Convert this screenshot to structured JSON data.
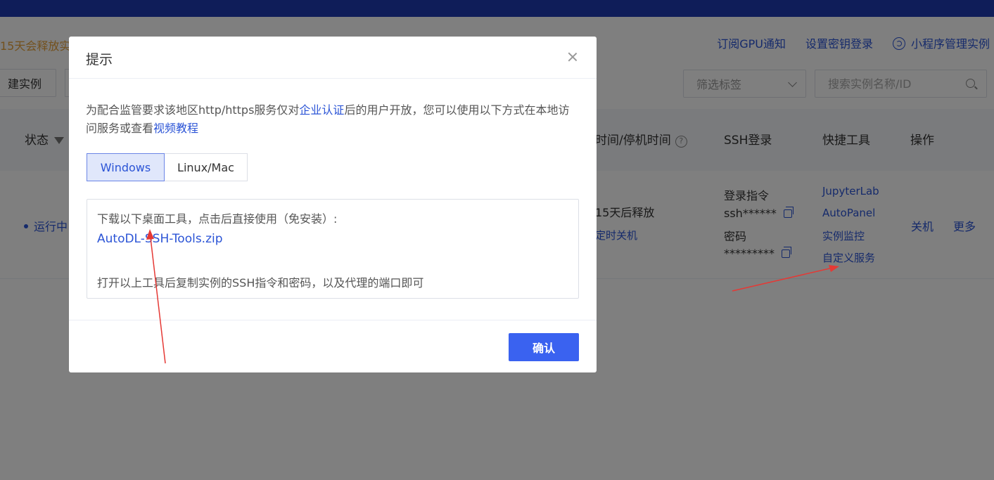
{
  "notice": "15天会释放实",
  "top_links": {
    "subscribe": "订阅GPU通知",
    "key_login": "设置密钥登录",
    "mini_program": "小程序管理实例"
  },
  "toolbar": {
    "create_label": "建实例",
    "filter_placeholder": "筛选标签",
    "search_placeholder": "搜索实例名称/ID"
  },
  "table": {
    "headers": {
      "status": "状态",
      "time": "时间/停机时间",
      "ssh": "SSH登录",
      "tools": "快捷工具",
      "ops": "操作"
    },
    "row": {
      "status": "运行中",
      "release": "15天后释放",
      "timer_shutdown": "定时关机",
      "ssh_cmd_label": "登录指令",
      "ssh_cmd": "ssh******",
      "pwd_label": "密码",
      "pwd": "*********",
      "tools": [
        "JupyterLab",
        "AutoPanel",
        "实例监控",
        "自定义服务"
      ],
      "op_shutdown": "关机",
      "op_more": "更多"
    }
  },
  "dialog": {
    "title": "提示",
    "desc_part1": "为配合监管要求该地区http/https服务仅对",
    "desc_link1": "企业认证",
    "desc_part2": "后的用户开放，您可以使用以下方式在本地访问服务或查看",
    "desc_link2": "视频教程",
    "tabs": [
      "Windows",
      "Linux/Mac"
    ],
    "active_tab": "Windows",
    "info_line1": "下载以下桌面工具，点击后直接使用（免安装）:",
    "download_link": "AutoDL-SSH-Tools.zip",
    "info_line3": "打开以上工具后复制实例的SSH指令和密码，以及代理的端口即可",
    "confirm_label": "确认"
  },
  "colors": {
    "accent": "#2b54d6",
    "primary_button": "#3a62f0",
    "topbar": "#1f3bb3",
    "annotation_arrow": "#e53935",
    "notice": "#e6a23c"
  }
}
